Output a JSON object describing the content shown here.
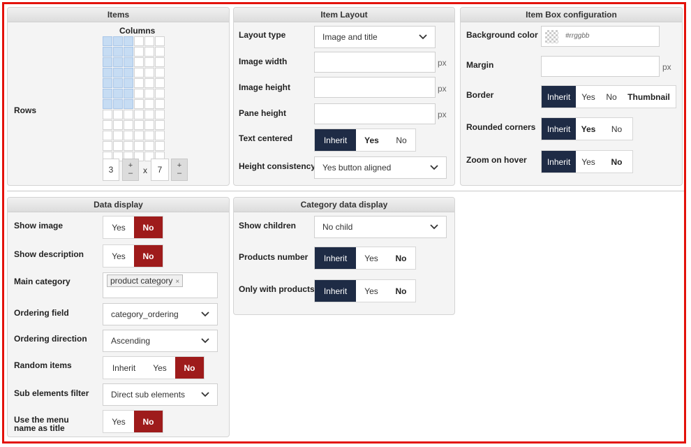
{
  "items_panel": {
    "title": "Items",
    "columns_label": "Columns",
    "rows_label": "Rows",
    "columns_value": "3",
    "rows_value": "7",
    "times": "x",
    "plus": "+",
    "minus": "–",
    "grid": {
      "total_columns": 6,
      "total_rows": 12,
      "selected_columns": 3,
      "selected_rows": 7
    }
  },
  "layout_panel": {
    "title": "Item Layout",
    "layout_type": {
      "label": "Layout type",
      "value": "Image and title"
    },
    "image_width": {
      "label": "Image width",
      "value": "",
      "unit": "px"
    },
    "image_height": {
      "label": "Image height",
      "value": "",
      "unit": "px"
    },
    "pane_height": {
      "label": "Pane height",
      "value": "",
      "unit": "px"
    },
    "text_centered": {
      "label": "Text centered",
      "options": [
        "Inherit",
        "Yes",
        "No"
      ],
      "selected": "Inherit"
    },
    "height_consistency": {
      "label": "Height consistency",
      "value": "Yes button aligned"
    }
  },
  "box_panel": {
    "title": "Item Box configuration",
    "background_color": {
      "label": "Background color",
      "placeholder": "#rrggbb"
    },
    "margin": {
      "label": "Margin",
      "value": "",
      "unit": "px"
    },
    "border": {
      "label": "Border",
      "options": [
        "Inherit",
        "Yes",
        "No",
        "Thumbnail"
      ],
      "selected": "Inherit"
    },
    "rounded_corners": {
      "label": "Rounded corners",
      "options": [
        "Inherit",
        "Yes",
        "No"
      ],
      "selected": "Inherit"
    },
    "zoom_on_hover": {
      "label": "Zoom on hover",
      "options": [
        "Inherit",
        "Yes",
        "No"
      ],
      "selected": "Inherit"
    }
  },
  "data_panel": {
    "title": "Data display",
    "show_image": {
      "label": "Show image",
      "options": [
        "Yes",
        "No"
      ],
      "selected": "No"
    },
    "show_description": {
      "label": "Show description",
      "options": [
        "Yes",
        "No"
      ],
      "selected": "No"
    },
    "main_category": {
      "label": "Main category",
      "tag": "product category",
      "remove": "×"
    },
    "ordering_field": {
      "label": "Ordering field",
      "value": "category_ordering"
    },
    "ordering_direction": {
      "label": "Ordering direction",
      "value": "Ascending"
    },
    "random_items": {
      "label": "Random items",
      "options": [
        "Inherit",
        "Yes",
        "No"
      ],
      "selected": "No"
    },
    "sub_elements_filter": {
      "label": "Sub elements filter",
      "value": "Direct sub elements"
    },
    "menu_name_title": {
      "label_line1": "Use the menu",
      "label_line2": "name as title",
      "options": [
        "Yes",
        "No"
      ],
      "selected": "No"
    }
  },
  "category_panel": {
    "title": "Category data display",
    "show_children": {
      "label": "Show children",
      "value": "No child"
    },
    "products_number": {
      "label": "Products number",
      "options": [
        "Inherit",
        "Yes",
        "No"
      ],
      "selected": "Inherit"
    },
    "only_with_products": {
      "label": "Only with products",
      "options": [
        "Inherit",
        "Yes",
        "No"
      ],
      "selected": "Inherit"
    }
  },
  "colors": {
    "selected_dark": "#1e2b45",
    "selected_red": "#9e1b1b",
    "frame": "#e3120b",
    "grid_on": "#c6dcf3"
  },
  "icons": {
    "dropdown": "chevron-down-icon",
    "color_swatch": "transparent-swatch-icon",
    "remove": "close-icon"
  }
}
